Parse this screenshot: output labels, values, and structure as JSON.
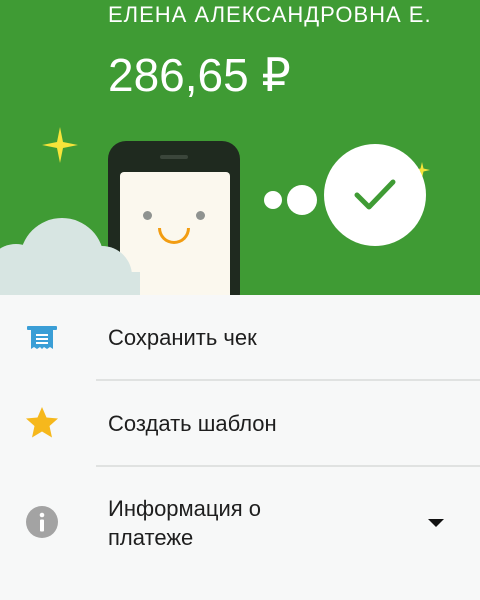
{
  "header": {
    "recipient_name": "ЕЛЕНА АЛЕКСАНДРОВНА Е.",
    "amount": "286,65 ₽",
    "background_color": "#3f9b34"
  },
  "illustration": {
    "icons": [
      "sparkle-icon",
      "phone-smiley",
      "success-check-icon",
      "cloud"
    ],
    "accent_yellow": "#f6e43a",
    "smile_color": "#f29d12"
  },
  "menu": {
    "items": [
      {
        "label": "Сохранить чек",
        "icon": "receipt-icon"
      },
      {
        "label": "Создать шаблон",
        "icon": "star-icon"
      },
      {
        "label": "Информация о\nплатеже",
        "icon": "info-icon",
        "expandable": true
      }
    ]
  }
}
